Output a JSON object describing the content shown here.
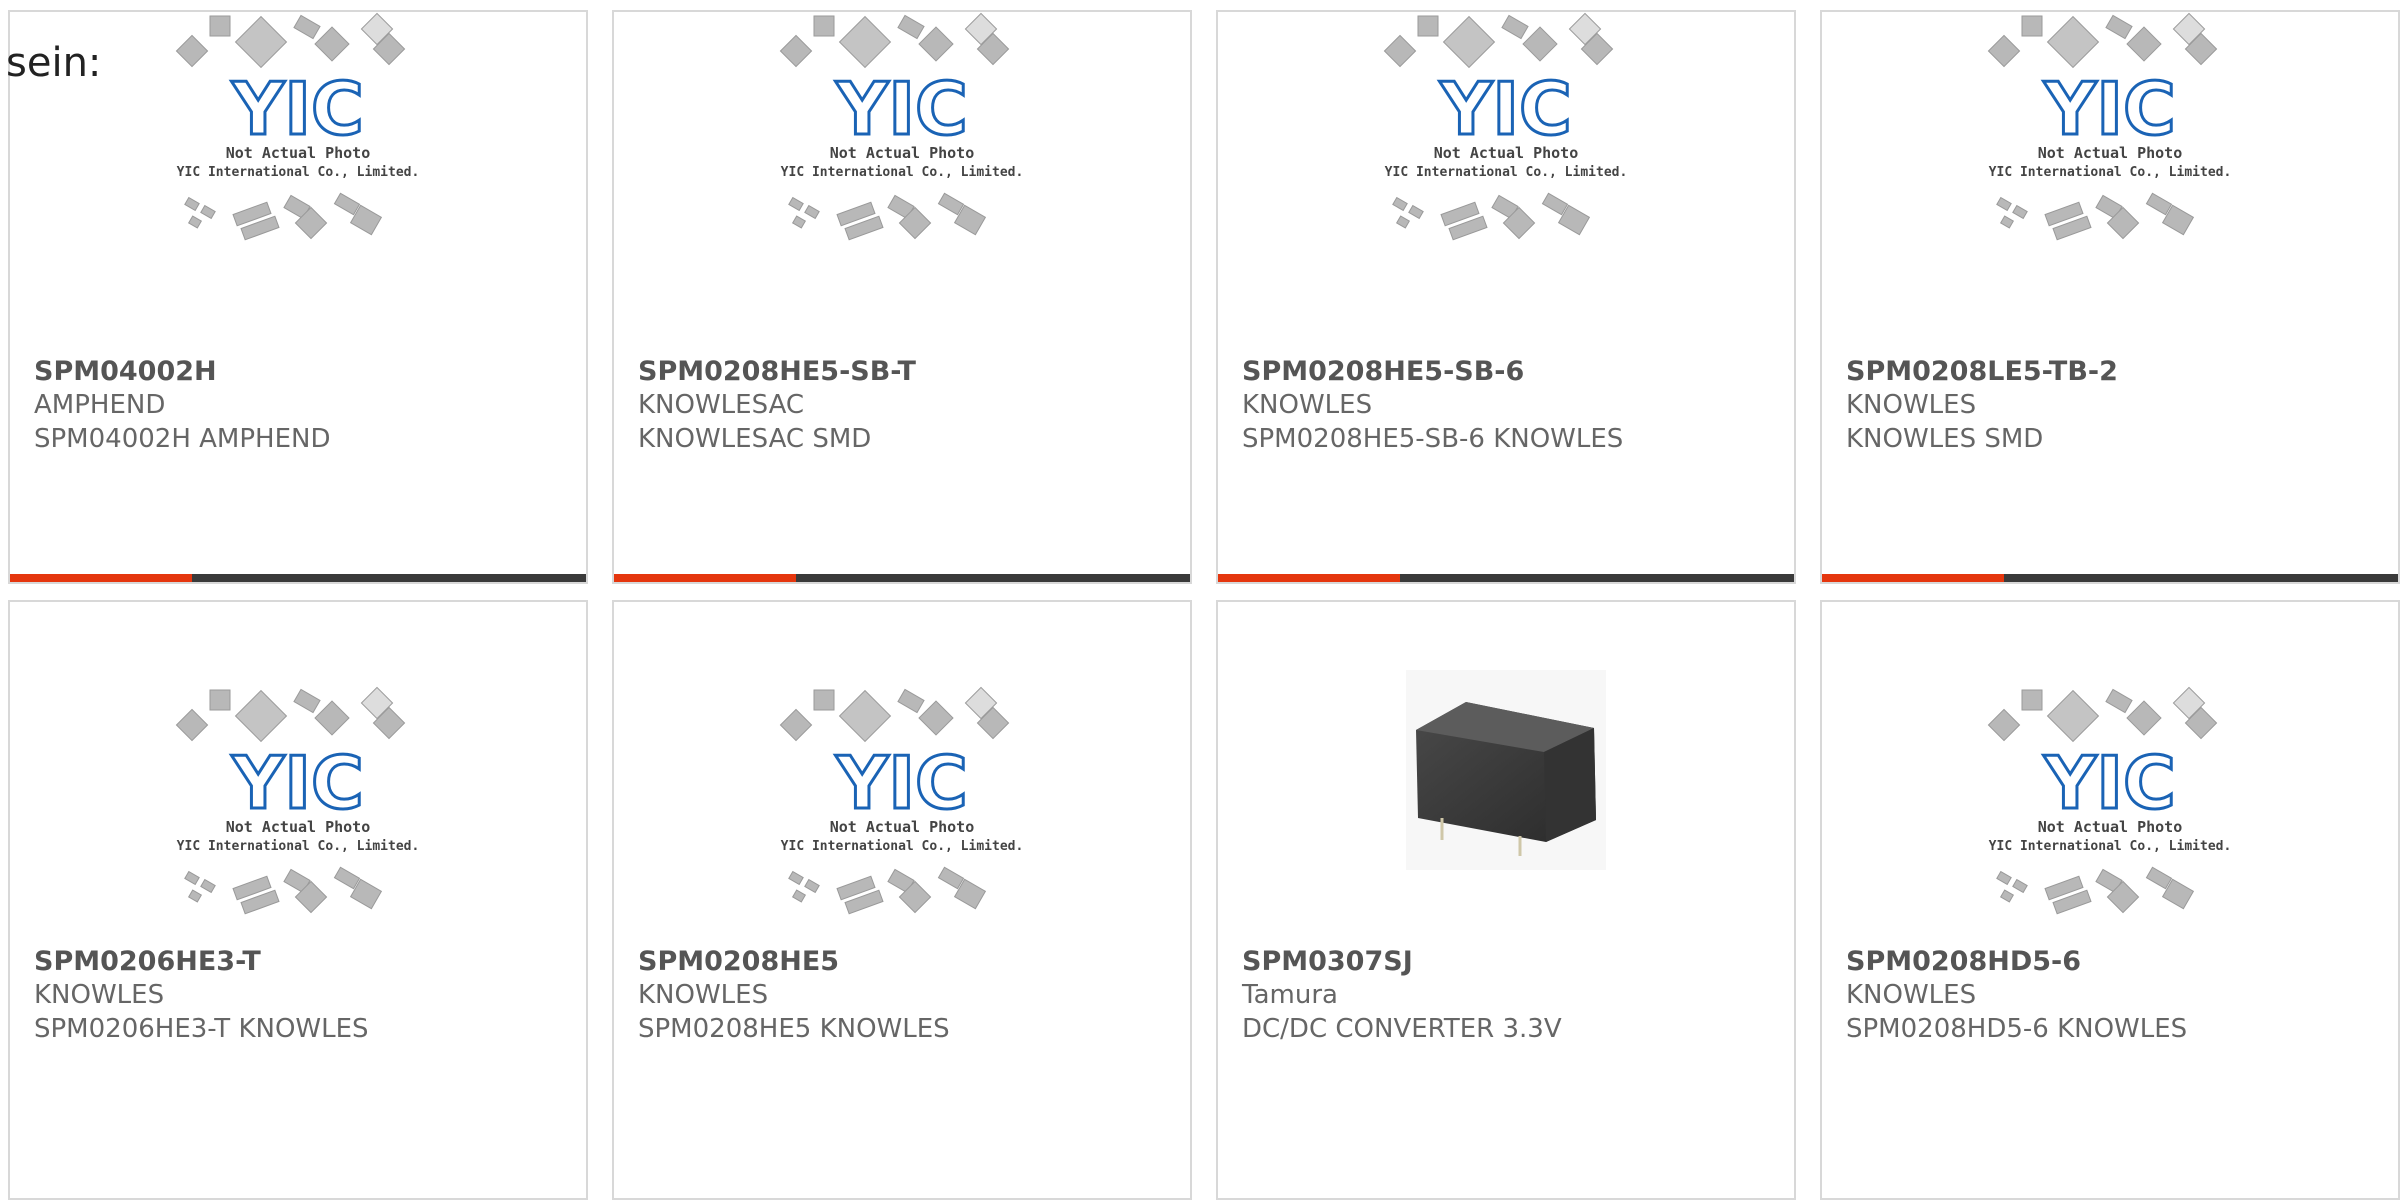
{
  "intro": "sein:",
  "placeholder_image": {
    "line1": "Not Actual Photo",
    "line2": "YIC International Co., Limited.",
    "logo_text": "YIC"
  },
  "colors": {
    "accent_red": "#e5360e",
    "dark_bar": "#3a3a3a",
    "logo_blue": "#1a63b5"
  },
  "products": [
    {
      "part": "SPM04002H",
      "maker": "AMPHEND",
      "desc": "SPM04002H AMPHEND",
      "image": "placeholder"
    },
    {
      "part": "SPM0208HE5-SB-T",
      "maker": "KNOWLESAC",
      "desc": "KNOWLESAC SMD",
      "image": "placeholder"
    },
    {
      "part": "SPM0208HE5-SB-6",
      "maker": "KNOWLES",
      "desc": "SPM0208HE5-SB-6 KNOWLES",
      "image": "placeholder"
    },
    {
      "part": "SPM0208LE5-TB-2",
      "maker": "KNOWLES",
      "desc": "KNOWLES SMD",
      "image": "placeholder"
    },
    {
      "part": "SPM0206HE3-T",
      "maker": "KNOWLES",
      "desc": "SPM0206HE3-T KNOWLES",
      "image": "placeholder"
    },
    {
      "part": "SPM0208HE5",
      "maker": "KNOWLES",
      "desc": "SPM0208HE5 KNOWLES",
      "image": "placeholder"
    },
    {
      "part": "SPM0307SJ",
      "maker": "Tamura",
      "desc": "DC/DC CONVERTER 3.3V",
      "image": "photo"
    },
    {
      "part": "SPM0208HD5-6",
      "maker": "KNOWLES",
      "desc": "SPM0208HD5-6 KNOWLES",
      "image": "placeholder"
    }
  ]
}
